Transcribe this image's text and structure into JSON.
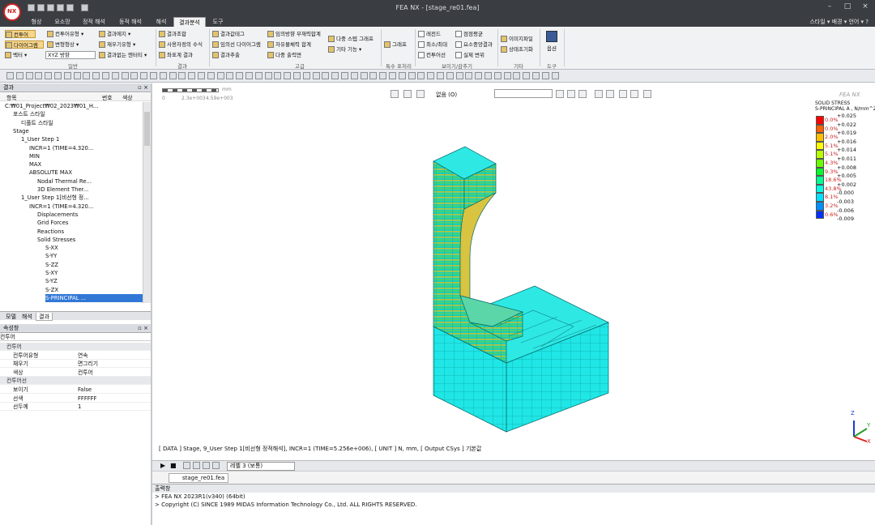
{
  "window": {
    "title": "FEA NX - [stage_re01.fea]",
    "logo": "NX"
  },
  "menu": {
    "tabs": [
      "형상",
      "요소망",
      "정적 해석",
      "동적 해석",
      "해석",
      "결과분석",
      "도구"
    ],
    "active": "결과분석",
    "right": "스타일 ▾  배경 ▾  언어 ▾  ?"
  },
  "ribbon": {
    "g1": {
      "items": [
        "컨투어",
        "컨투어유형 ▾",
        "결과에지 ▾",
        "다이어그램",
        "변형형상 ▾",
        "재우기유형 ▾",
        "벡터 ▾",
        "결과없는 엔터티 ▾"
      ],
      "dropdown": "XYZ 방향",
      "label": "일반"
    },
    "g2": {
      "items": [
        "결과조합",
        "사용자정의 수식",
        "좌표계 결과"
      ],
      "label": "결과"
    },
    "g3": {
      "items": [
        "결과값테그",
        "임의선 다이어그램",
        "결과추출",
        "임의방향 부재력합계",
        "자유물체력 합계",
        "다중 출력면",
        "다중 스텝 그래프",
        "기타 기능 ▾"
      ],
      "label": "고급"
    },
    "g4": {
      "items": [
        "그래프"
      ],
      "label": "특수 표처리"
    },
    "g5": {
      "items": [
        "레전드",
        "최소/최대",
        "컨투어선",
        "점점평균",
        "요소중앙결과",
        "실제 변위"
      ],
      "label": "보이기/감추기"
    },
    "g6": {
      "items": [
        "이미지파일",
        "상태초기화"
      ],
      "label": "기타"
    },
    "g7": {
      "items": [
        "옵션"
      ],
      "label": "도구"
    }
  },
  "result_panel": {
    "title": "결과",
    "columns": [
      "항목",
      "번호",
      "색상"
    ],
    "tree": [
      {
        "label": "C:₩01_Project₩02_2023₩01_H...",
        "indent": 0
      },
      {
        "label": "포스트 스타일",
        "indent": 1
      },
      {
        "label": "디폴트 스타일",
        "indent": 2
      },
      {
        "label": "Stage",
        "indent": 1
      },
      {
        "label": "1_User Step 1",
        "indent": 2
      },
      {
        "label": "INCR=1 (TIME=4.320...",
        "indent": 3
      },
      {
        "label": "MIN",
        "indent": 3
      },
      {
        "label": "MAX",
        "indent": 3
      },
      {
        "label": "ABSOLUTE MAX",
        "indent": 3
      },
      {
        "label": "Nodal Thermal Re...",
        "indent": 4
      },
      {
        "label": "3D Element Ther...",
        "indent": 4
      },
      {
        "label": "1_User Step 1[비선형 정...",
        "indent": 2
      },
      {
        "label": "INCR=1 (TIME=4.320...",
        "indent": 3
      },
      {
        "label": "Displacements",
        "indent": 4
      },
      {
        "label": "Grid Forces",
        "indent": 4
      },
      {
        "label": "Reactions",
        "indent": 4
      },
      {
        "label": "Solid Stresses",
        "indent": 4
      },
      {
        "label": "S-XX",
        "indent": 5
      },
      {
        "label": "S-YY",
        "indent": 5
      },
      {
        "label": "S-ZZ",
        "indent": 5
      },
      {
        "label": "S-XY",
        "indent": 5
      },
      {
        "label": "S-YZ",
        "indent": 5
      },
      {
        "label": "S-ZX",
        "indent": 5
      },
      {
        "label": "S-PRINCIPAL ...",
        "indent": 5
      }
    ],
    "bottom_tabs": [
      "모델",
      "해석",
      "결과"
    ]
  },
  "properties": {
    "title": "속성창",
    "subject": "컨투어",
    "rows": [
      {
        "cat": "컨투어"
      },
      {
        "k": "컨투어유형",
        "v": "연속"
      },
      {
        "k": "채우기",
        "v": "면그리기"
      },
      {
        "k": "색상",
        "v": "컨투어"
      },
      {
        "cat": "컨투어선"
      },
      {
        "k": "보이기",
        "v": "False"
      },
      {
        "k": "선색",
        "v": "FFFFFF"
      },
      {
        "k": "선두께",
        "v": "1"
      }
    ]
  },
  "viewport": {
    "scale_unit": "mm",
    "scale_ticks": [
      "0",
      "2.3e+003",
      "4.59e+003"
    ],
    "ortho": "없음 (O)",
    "brand": "FEA NX",
    "status": "[ DATA ] Stage,  9_User Step 1[비선형 정적해석],  INCR=1 (TIME=5.256e+006),  [ UNIT ]  N, mm,  [ Output CSys ]  기본값",
    "axes": [
      "X",
      "Y",
      "Z"
    ]
  },
  "legend": {
    "title1": "SOLID STRESS",
    "title2": "S-PRINCIPAL A , N/mm^2",
    "colors": [
      "#ff0000",
      "#ff6000",
      "#ffbf00",
      "#ffff00",
      "#b6ff00",
      "#6aff00",
      "#00ff2a",
      "#00ff90",
      "#00ffe4",
      "#00e0ff",
      "#0090ff",
      "#0030ff"
    ],
    "percents": [
      "0.0%",
      "0.0%",
      "2.0%",
      "5.1%",
      "5.1%",
      "4.3%",
      "9.3%",
      "18.6%",
      "43.8%",
      "8.1%",
      "3.2%",
      "0.6%"
    ],
    "values": [
      "+0.025",
      "+0.022",
      "+0.019",
      "+0.016",
      "+0.014",
      "+0.011",
      "+0.008",
      "+0.005",
      "+0.002",
      "-0.000",
      "-0.003",
      "-0.006",
      "-0.009"
    ]
  },
  "playbar": {
    "level": "레벨 3 (보통)"
  },
  "doc_tab": "stage_re01.fea",
  "output": {
    "title": "출력창",
    "lines": [
      "> FEA NX 2023R1(v340) (64bit)",
      "> Copyright (C) SINCE 1989 MIDAS Information Technology Co., Ltd. ALL RIGHTS RESERVED."
    ]
  }
}
